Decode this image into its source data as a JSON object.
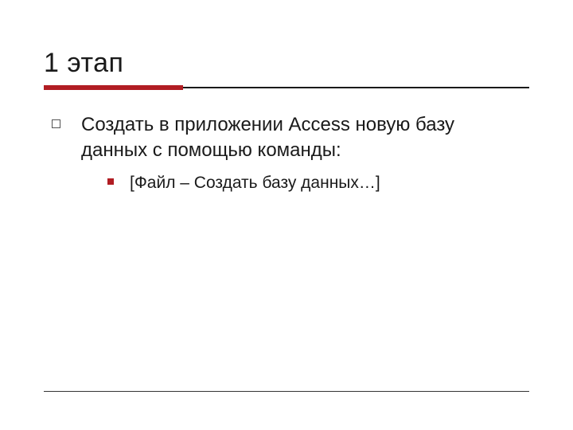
{
  "colors": {
    "accent": "#b11d23"
  },
  "title": "1 этап",
  "items": [
    {
      "text": "Создать в приложении Access новую базу данных с помощью команды:",
      "sub": [
        "[Файл – Создать базу данных…]"
      ]
    }
  ]
}
